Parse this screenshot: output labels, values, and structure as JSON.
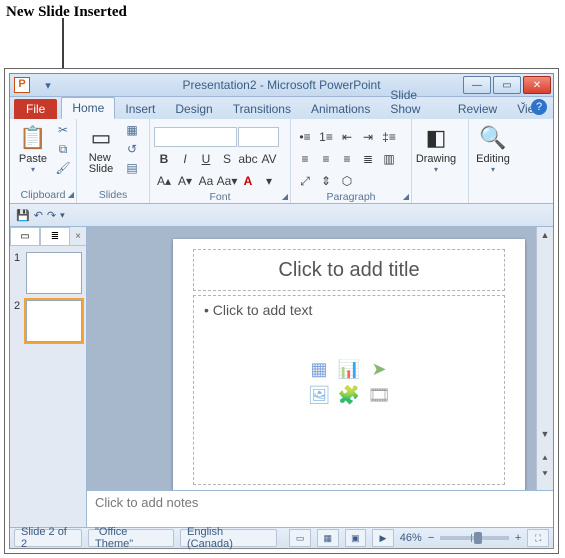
{
  "caption": "New Slide Inserted",
  "title": "Presentation2 - Microsoft PowerPoint",
  "tabs": {
    "file": "File",
    "home": "Home",
    "insert": "Insert",
    "design": "Design",
    "transitions": "Transitions",
    "animations": "Animations",
    "slideshow": "Slide Show",
    "review": "Review",
    "view": "View"
  },
  "ribbon": {
    "clipboard": {
      "label": "Clipboard",
      "paste": "Paste"
    },
    "slides": {
      "label": "Slides",
      "newslide": "New\nSlide"
    },
    "font": {
      "label": "Font",
      "family_placeholder": " ",
      "size_placeholder": " "
    },
    "para": {
      "label": "Paragraph"
    },
    "drawing": {
      "label": "Drawing",
      "btn": "Drawing"
    },
    "editing": {
      "label": "Editing",
      "btn": "Editing"
    }
  },
  "thumbs": [
    {
      "num": "1"
    },
    {
      "num": "2"
    }
  ],
  "slide": {
    "title_placeholder": "Click to add title",
    "body_placeholder": "Click to add text"
  },
  "notes_placeholder": "Click to add notes",
  "status": {
    "slide": "Slide 2 of 2",
    "theme": "\"Office Theme\"",
    "lang": "English (Canada)",
    "zoom": "46%"
  }
}
